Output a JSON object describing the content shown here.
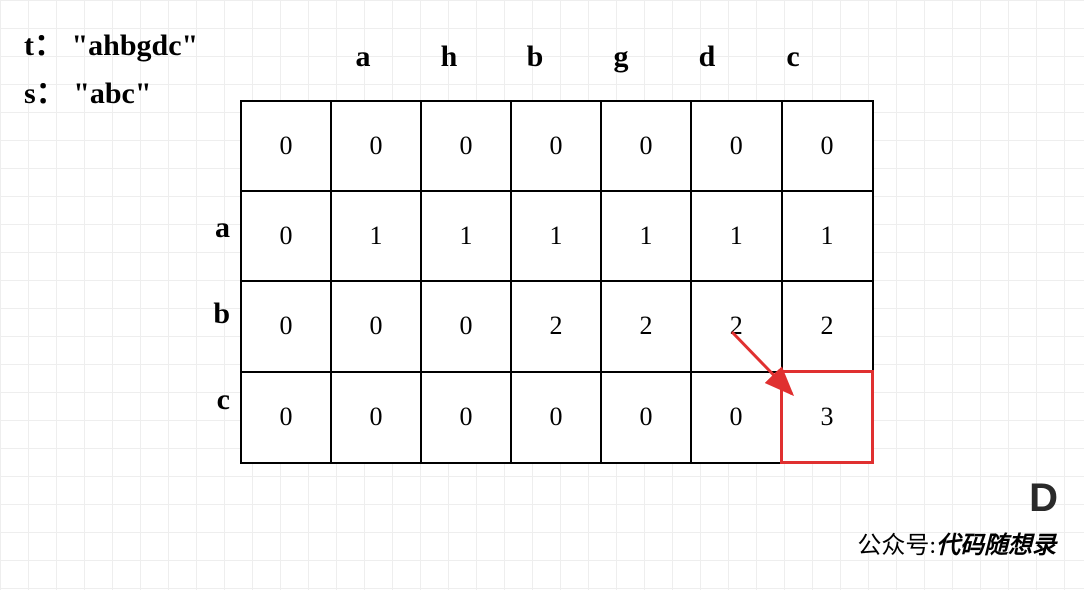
{
  "strings": {
    "t_label": "t：",
    "t_value": "\"ahbgdc\"",
    "s_label": "s：",
    "s_value": "\"abc\""
  },
  "col_headers": [
    "a",
    "h",
    "b",
    "g",
    "d",
    "c"
  ],
  "row_headers": [
    "a",
    "b",
    "c"
  ],
  "chart_data": {
    "type": "table",
    "title": "DP table for subsequence check",
    "t": "ahbgdc",
    "s": "abc",
    "columns": [
      "",
      "a",
      "h",
      "b",
      "g",
      "d",
      "c"
    ],
    "rows": [
      "",
      "a",
      "b",
      "c"
    ],
    "grid": [
      [
        0,
        0,
        0,
        0,
        0,
        0,
        0
      ],
      [
        0,
        1,
        1,
        1,
        1,
        1,
        1
      ],
      [
        0,
        0,
        0,
        2,
        2,
        2,
        2
      ],
      [
        0,
        0,
        0,
        0,
        0,
        0,
        3
      ]
    ],
    "highlight_cell": {
      "row": 3,
      "col": 6
    },
    "arrow": {
      "from": {
        "row": 2,
        "col": 5
      },
      "to": {
        "row": 3,
        "col": 6
      }
    }
  },
  "watermark": {
    "logo_text": "D",
    "prefix": "公众号:",
    "name": "代码随想录"
  }
}
